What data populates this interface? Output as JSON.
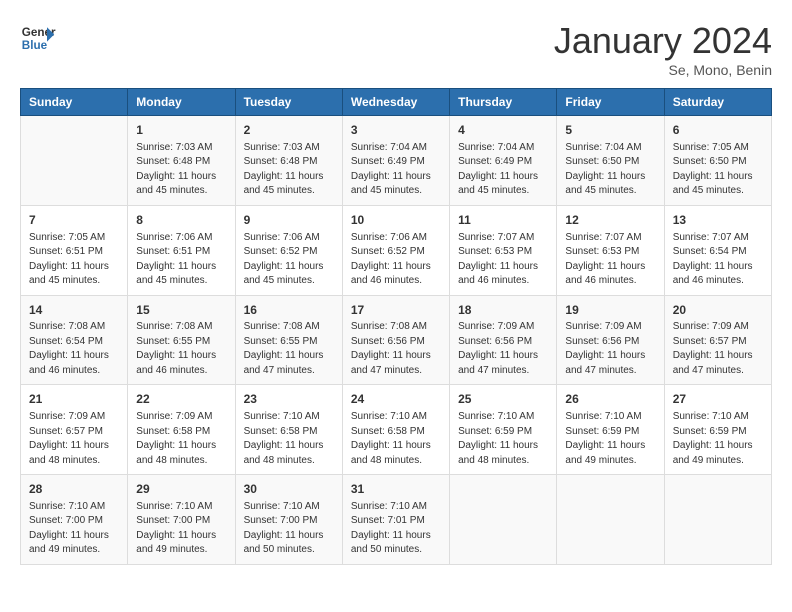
{
  "header": {
    "logo": {
      "line1": "General",
      "line2": "Blue"
    },
    "title": "January 2024",
    "location": "Se, Mono, Benin"
  },
  "days_of_week": [
    "Sunday",
    "Monday",
    "Tuesday",
    "Wednesday",
    "Thursday",
    "Friday",
    "Saturday"
  ],
  "weeks": [
    [
      {
        "day": "",
        "info": ""
      },
      {
        "day": "1",
        "info": "Sunrise: 7:03 AM\nSunset: 6:48 PM\nDaylight: 11 hours\nand 45 minutes."
      },
      {
        "day": "2",
        "info": "Sunrise: 7:03 AM\nSunset: 6:48 PM\nDaylight: 11 hours\nand 45 minutes."
      },
      {
        "day": "3",
        "info": "Sunrise: 7:04 AM\nSunset: 6:49 PM\nDaylight: 11 hours\nand 45 minutes."
      },
      {
        "day": "4",
        "info": "Sunrise: 7:04 AM\nSunset: 6:49 PM\nDaylight: 11 hours\nand 45 minutes."
      },
      {
        "day": "5",
        "info": "Sunrise: 7:04 AM\nSunset: 6:50 PM\nDaylight: 11 hours\nand 45 minutes."
      },
      {
        "day": "6",
        "info": "Sunrise: 7:05 AM\nSunset: 6:50 PM\nDaylight: 11 hours\nand 45 minutes."
      }
    ],
    [
      {
        "day": "7",
        "info": "Sunrise: 7:05 AM\nSunset: 6:51 PM\nDaylight: 11 hours\nand 45 minutes."
      },
      {
        "day": "8",
        "info": "Sunrise: 7:06 AM\nSunset: 6:51 PM\nDaylight: 11 hours\nand 45 minutes."
      },
      {
        "day": "9",
        "info": "Sunrise: 7:06 AM\nSunset: 6:52 PM\nDaylight: 11 hours\nand 45 minutes."
      },
      {
        "day": "10",
        "info": "Sunrise: 7:06 AM\nSunset: 6:52 PM\nDaylight: 11 hours\nand 46 minutes."
      },
      {
        "day": "11",
        "info": "Sunrise: 7:07 AM\nSunset: 6:53 PM\nDaylight: 11 hours\nand 46 minutes."
      },
      {
        "day": "12",
        "info": "Sunrise: 7:07 AM\nSunset: 6:53 PM\nDaylight: 11 hours\nand 46 minutes."
      },
      {
        "day": "13",
        "info": "Sunrise: 7:07 AM\nSunset: 6:54 PM\nDaylight: 11 hours\nand 46 minutes."
      }
    ],
    [
      {
        "day": "14",
        "info": "Sunrise: 7:08 AM\nSunset: 6:54 PM\nDaylight: 11 hours\nand 46 minutes."
      },
      {
        "day": "15",
        "info": "Sunrise: 7:08 AM\nSunset: 6:55 PM\nDaylight: 11 hours\nand 46 minutes."
      },
      {
        "day": "16",
        "info": "Sunrise: 7:08 AM\nSunset: 6:55 PM\nDaylight: 11 hours\nand 47 minutes."
      },
      {
        "day": "17",
        "info": "Sunrise: 7:08 AM\nSunset: 6:56 PM\nDaylight: 11 hours\nand 47 minutes."
      },
      {
        "day": "18",
        "info": "Sunrise: 7:09 AM\nSunset: 6:56 PM\nDaylight: 11 hours\nand 47 minutes."
      },
      {
        "day": "19",
        "info": "Sunrise: 7:09 AM\nSunset: 6:56 PM\nDaylight: 11 hours\nand 47 minutes."
      },
      {
        "day": "20",
        "info": "Sunrise: 7:09 AM\nSunset: 6:57 PM\nDaylight: 11 hours\nand 47 minutes."
      }
    ],
    [
      {
        "day": "21",
        "info": "Sunrise: 7:09 AM\nSunset: 6:57 PM\nDaylight: 11 hours\nand 48 minutes."
      },
      {
        "day": "22",
        "info": "Sunrise: 7:09 AM\nSunset: 6:58 PM\nDaylight: 11 hours\nand 48 minutes."
      },
      {
        "day": "23",
        "info": "Sunrise: 7:10 AM\nSunset: 6:58 PM\nDaylight: 11 hours\nand 48 minutes."
      },
      {
        "day": "24",
        "info": "Sunrise: 7:10 AM\nSunset: 6:58 PM\nDaylight: 11 hours\nand 48 minutes."
      },
      {
        "day": "25",
        "info": "Sunrise: 7:10 AM\nSunset: 6:59 PM\nDaylight: 11 hours\nand 48 minutes."
      },
      {
        "day": "26",
        "info": "Sunrise: 7:10 AM\nSunset: 6:59 PM\nDaylight: 11 hours\nand 49 minutes."
      },
      {
        "day": "27",
        "info": "Sunrise: 7:10 AM\nSunset: 6:59 PM\nDaylight: 11 hours\nand 49 minutes."
      }
    ],
    [
      {
        "day": "28",
        "info": "Sunrise: 7:10 AM\nSunset: 7:00 PM\nDaylight: 11 hours\nand 49 minutes."
      },
      {
        "day": "29",
        "info": "Sunrise: 7:10 AM\nSunset: 7:00 PM\nDaylight: 11 hours\nand 49 minutes."
      },
      {
        "day": "30",
        "info": "Sunrise: 7:10 AM\nSunset: 7:00 PM\nDaylight: 11 hours\nand 50 minutes."
      },
      {
        "day": "31",
        "info": "Sunrise: 7:10 AM\nSunset: 7:01 PM\nDaylight: 11 hours\nand 50 minutes."
      },
      {
        "day": "",
        "info": ""
      },
      {
        "day": "",
        "info": ""
      },
      {
        "day": "",
        "info": ""
      }
    ]
  ]
}
